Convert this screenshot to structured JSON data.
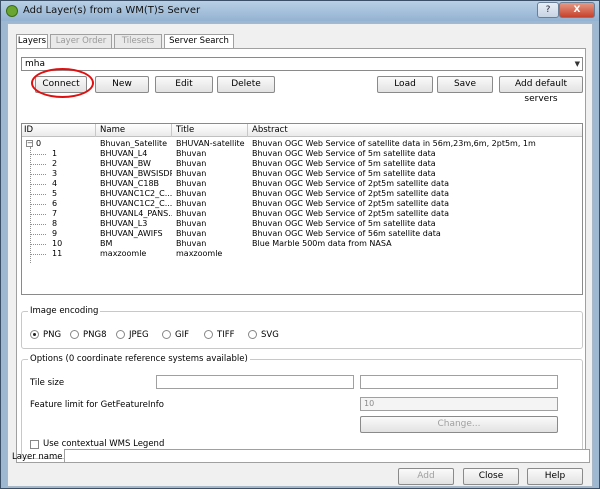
{
  "window": {
    "title": "Add Layer(s) from a WM(T)S Server",
    "help_glyph": "?",
    "close_glyph": "X"
  },
  "tabs": [
    {
      "label": "Layers",
      "active": true
    },
    {
      "label": "Layer Order",
      "active": false
    },
    {
      "label": "Tilesets",
      "active": false
    },
    {
      "label": "Server Search",
      "active": true
    }
  ],
  "connection": {
    "selected": "mha",
    "buttons": {
      "connect": "Connect",
      "new": "New",
      "edit": "Edit",
      "delete": "Delete",
      "load": "Load",
      "save": "Save",
      "add_default": "Add default servers"
    }
  },
  "layers_table": {
    "columns": [
      "ID",
      "Name",
      "Title",
      "Abstract"
    ],
    "rows": [
      {
        "id": "0",
        "name": "Bhuvan_Satellite",
        "title": "BHUVAN-satellite",
        "abstract": "Bhuvan OGC Web Service of satellite data in 56m,23m,6m, 2pt5m, 1m",
        "root": true
      },
      {
        "id": "1",
        "name": "BHUVAN_L4",
        "title": "Bhuvan",
        "abstract": "Bhuvan OGC Web Service of 5m satellite data"
      },
      {
        "id": "2",
        "name": "BHUVAN_BW",
        "title": "Bhuvan",
        "abstract": "Bhuvan OGC Web Service of 5m satellite data"
      },
      {
        "id": "3",
        "name": "BHUVAN_BWSISDP",
        "title": "Bhuvan",
        "abstract": "Bhuvan OGC Web Service of 5m satellite data"
      },
      {
        "id": "4",
        "name": "BHUVAN_C18B",
        "title": "Bhuvan",
        "abstract": "Bhuvan OGC Web Service of 2pt5m satellite data"
      },
      {
        "id": "5",
        "name": "BHUVANC1C2_C...",
        "title": "Bhuvan",
        "abstract": "Bhuvan OGC Web Service of 2pt5m satellite data"
      },
      {
        "id": "6",
        "name": "BHUVANC1C2_C...",
        "title": "Bhuvan",
        "abstract": "Bhuvan OGC Web Service of 2pt5m satellite data"
      },
      {
        "id": "7",
        "name": "BHUVANL4_PANS...",
        "title": "Bhuvan",
        "abstract": "Bhuvan OGC Web Service of 2pt5m satellite data"
      },
      {
        "id": "8",
        "name": "BHUVAN_L3",
        "title": "Bhuvan",
        "abstract": "Bhuvan OGC Web Service of 5m satellite data"
      },
      {
        "id": "9",
        "name": "BHUVAN_AWIFS",
        "title": "Bhuvan",
        "abstract": "Bhuvan OGC Web Service of 56m satellite data"
      },
      {
        "id": "10",
        "name": "BM",
        "title": "Bhuvan",
        "abstract": "Blue Marble 500m data from NASA"
      },
      {
        "id": "11",
        "name": "maxzoomle",
        "title": "maxzoomle",
        "abstract": ""
      }
    ]
  },
  "image_encoding": {
    "title": "Image encoding",
    "options": [
      "PNG",
      "PNG8",
      "JPEG",
      "GIF",
      "TIFF",
      "SVG"
    ],
    "selected": "PNG"
  },
  "options": {
    "title": "Options (0 coordinate reference systems available)",
    "tile_size_label": "Tile size",
    "feature_limit_label": "Feature limit for GetFeatureInfo",
    "feature_limit_value": "10",
    "change_button": "Change...",
    "contextual_legend_label": "Use contextual WMS Legend"
  },
  "layer_name_label": "Layer name",
  "footer": {
    "add": "Add",
    "close": "Close",
    "help": "Help"
  }
}
